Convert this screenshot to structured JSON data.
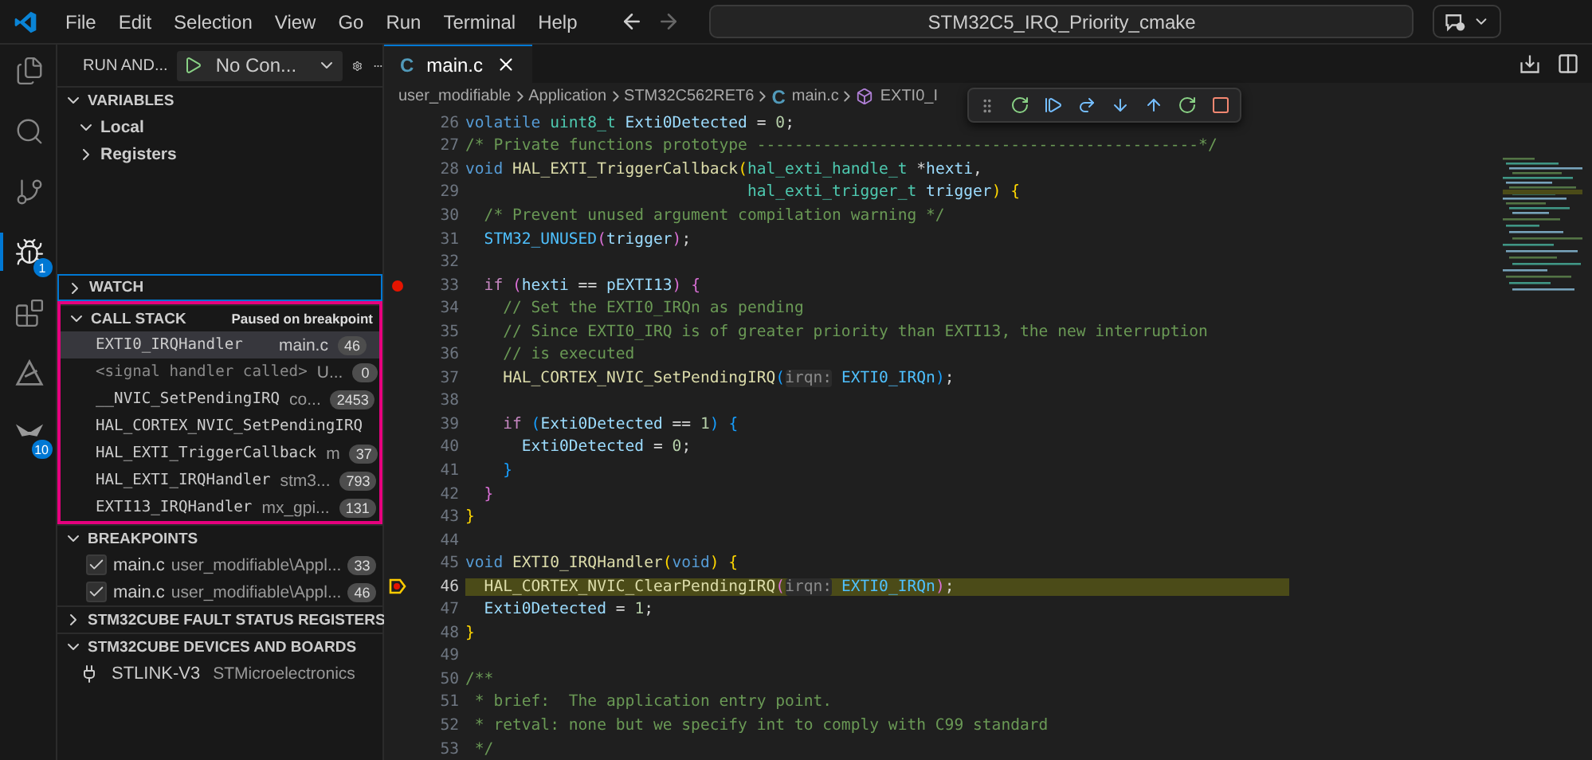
{
  "menu": [
    "File",
    "Edit",
    "Selection",
    "View",
    "Go",
    "Run",
    "Terminal",
    "Help"
  ],
  "command_center": {
    "value": "STM32C5_IRQ_Priority_cmake"
  },
  "activity_bar": [
    {
      "kind": "files",
      "selected": false
    },
    {
      "kind": "search",
      "selected": false
    },
    {
      "kind": "source-control",
      "selected": false
    },
    {
      "kind": "debug",
      "selected": true,
      "badge": "1"
    },
    {
      "kind": "extensions",
      "selected": false
    },
    {
      "kind": "triangle",
      "selected": false
    },
    {
      "kind": "stm",
      "selected": false,
      "badge": "10"
    }
  ],
  "sidebar": {
    "title": "RUN AND...",
    "config": "No Con...",
    "variables": {
      "title": "VARIABLES",
      "expanded": true,
      "items": [
        {
          "label": "Local",
          "expanded": true
        },
        {
          "label": "Registers",
          "expanded": false
        }
      ]
    },
    "watch": {
      "title": "WATCH",
      "expanded": false
    },
    "call_stack": {
      "title": "CALL STACK",
      "expanded": true,
      "status": "Paused on breakpoint",
      "frames": [
        {
          "name": "EXTI0_IRQHandler",
          "file": "main.c",
          "line": "46",
          "selected": true,
          "dimmed": false
        },
        {
          "name": "<signal handler called>",
          "file": "U...",
          "line": "0",
          "selected": false,
          "dimmed": true
        },
        {
          "name": "__NVIC_SetPendingIRQ",
          "file": "co...",
          "line": "2453",
          "selected": false,
          "dimmed": false
        },
        {
          "name": "HAL_CORTEX_NVIC_SetPendingIRQ",
          "selected": false,
          "dimmed": false
        },
        {
          "name": "HAL_EXTI_TriggerCallback",
          "file": "m",
          "line": "37",
          "selected": false,
          "dimmed": false
        },
        {
          "name": "HAL_EXTI_IRQHandler",
          "file": "stm3...",
          "line": "793",
          "selected": false,
          "dimmed": false
        },
        {
          "name": "EXTI13_IRQHandler",
          "file": "mx_gpi...",
          "line": "131",
          "selected": false,
          "dimmed": false
        }
      ]
    },
    "breakpoints": {
      "title": "BREAKPOINTS",
      "expanded": true,
      "items": [
        {
          "file": "main.c",
          "path": "user_modifiable\\Appl...",
          "line": "33",
          "checked": true
        },
        {
          "file": "main.c",
          "path": "user_modifiable\\Appl...",
          "line": "46",
          "checked": true
        }
      ]
    },
    "fault": {
      "title": "STM32CUBE FAULT STATUS REGISTERS",
      "expanded": false
    },
    "devices": {
      "title": "STM32CUBE DEVICES AND BOARDS",
      "expanded": true,
      "items": [
        {
          "name": "STLINK-V3",
          "vendor": "STMicroelectronics"
        }
      ]
    }
  },
  "editor": {
    "tab": {
      "label": "main.c",
      "icon": "C"
    },
    "breadcrumbs": [
      {
        "label": "user_modifiable",
        "kind": "folder"
      },
      {
        "label": "Application",
        "kind": "folder"
      },
      {
        "label": "STM32C562RET6",
        "kind": "folder"
      },
      {
        "label": "main.c",
        "kind": "file",
        "icon": "C"
      },
      {
        "label": "EXTI0_I",
        "kind": "symbol"
      }
    ],
    "lines": [
      {
        "number": "26",
        "breakpoint": false,
        "current": false,
        "tokens": [
          {
            "t": "volatile ",
            "kind": "kw"
          },
          {
            "t": "uint8_t ",
            "kind": "type"
          },
          {
            "t": "Exti0Detected",
            "kind": "var"
          },
          {
            "t": " = ",
            "kind": "punc"
          },
          {
            "t": "0",
            "kind": "num"
          },
          {
            "t": ";",
            "kind": "punc"
          }
        ]
      },
      {
        "number": "27",
        "breakpoint": false,
        "current": false,
        "tokens": [
          {
            "t": "/* Private functions prototype -----------------------------------------------*/",
            "kind": "comment"
          }
        ]
      },
      {
        "number": "28",
        "breakpoint": false,
        "current": false,
        "tokens": [
          {
            "t": "void ",
            "kind": "kw"
          },
          {
            "t": "HAL_EXTI_TriggerCallback",
            "kind": "fn"
          },
          {
            "t": "(",
            "kind": "b1"
          },
          {
            "t": "hal_exti_handle_t",
            "kind": "type"
          },
          {
            "t": " *",
            "kind": "punc"
          },
          {
            "t": "hexti",
            "kind": "var"
          },
          {
            "t": ",",
            "kind": "punc"
          }
        ]
      },
      {
        "number": "29",
        "breakpoint": false,
        "current": false,
        "tokens": [
          {
            "t": "                              hal_exti_trigger_t ",
            "kind": "type"
          },
          {
            "t": "trigger",
            "kind": "var"
          },
          {
            "t": ")",
            "kind": "b1"
          },
          {
            "t": " {",
            "kind": "b1"
          }
        ]
      },
      {
        "number": "30",
        "breakpoint": false,
        "current": false,
        "tokens": [
          {
            "t": "  /* Prevent unused argument compilation warning */",
            "kind": "comment"
          }
        ]
      },
      {
        "number": "31",
        "breakpoint": false,
        "current": false,
        "tokens": [
          {
            "t": "  STM32_UNUSED",
            "kind": "macro"
          },
          {
            "t": "(",
            "kind": "b2"
          },
          {
            "t": "trigger",
            "kind": "var"
          },
          {
            "t": ")",
            "kind": "b2"
          },
          {
            "t": ";",
            "kind": "punc"
          }
        ]
      },
      {
        "number": "32",
        "breakpoint": false,
        "current": false
      },
      {
        "number": "33",
        "breakpoint": true,
        "current": false,
        "tokens": [
          {
            "t": "  if ",
            "kind": "ctl"
          },
          {
            "t": "(",
            "kind": "b2"
          },
          {
            "t": "hexti",
            "kind": "var"
          },
          {
            "t": " == ",
            "kind": "punc"
          },
          {
            "t": "pEXTI13",
            "kind": "var"
          },
          {
            "t": ")",
            "kind": "b2"
          },
          {
            "t": " {",
            "kind": "b2"
          }
        ]
      },
      {
        "number": "34",
        "breakpoint": false,
        "current": false,
        "tokens": [
          {
            "t": "    // Set the EXTI0_IRQn as pending",
            "kind": "comment"
          }
        ]
      },
      {
        "number": "35",
        "breakpoint": false,
        "current": false,
        "tokens": [
          {
            "t": "    // Since EXTI0_IRQ is of greater priority than EXTI13, the new interruption",
            "kind": "comment"
          }
        ]
      },
      {
        "number": "36",
        "breakpoint": false,
        "current": false,
        "tokens": [
          {
            "t": "    // is executed",
            "kind": "comment"
          }
        ]
      },
      {
        "number": "37",
        "breakpoint": false,
        "current": false,
        "tokens": [
          {
            "t": "    HAL_CORTEX_NVIC_SetPendingIRQ",
            "kind": "fn"
          },
          {
            "t": "(",
            "kind": "b3"
          },
          {
            "t": "irqn:",
            "kind": "hint"
          },
          {
            "t": " EXTI0_IRQn",
            "kind": "macro"
          },
          {
            "t": ")",
            "kind": "b3"
          },
          {
            "t": ";",
            "kind": "punc"
          }
        ]
      },
      {
        "number": "38",
        "breakpoint": false,
        "current": false
      },
      {
        "number": "39",
        "breakpoint": false,
        "current": false,
        "tokens": [
          {
            "t": "    if ",
            "kind": "ctl"
          },
          {
            "t": "(",
            "kind": "b3"
          },
          {
            "t": "Exti0Detected",
            "kind": "var"
          },
          {
            "t": " == ",
            "kind": "punc"
          },
          {
            "t": "1",
            "kind": "num"
          },
          {
            "t": ")",
            "kind": "b3"
          },
          {
            "t": " {",
            "kind": "b3"
          }
        ]
      },
      {
        "number": "40",
        "breakpoint": false,
        "current": false,
        "tokens": [
          {
            "t": "      Exti0Detected",
            "kind": "var"
          },
          {
            "t": " = ",
            "kind": "punc"
          },
          {
            "t": "0",
            "kind": "num"
          },
          {
            "t": ";",
            "kind": "punc"
          }
        ]
      },
      {
        "number": "41",
        "breakpoint": false,
        "current": false,
        "tokens": [
          {
            "t": "    }",
            "kind": "b3"
          }
        ]
      },
      {
        "number": "42",
        "breakpoint": false,
        "current": false,
        "tokens": [
          {
            "t": "  }",
            "kind": "b2"
          }
        ]
      },
      {
        "number": "43",
        "breakpoint": false,
        "current": false,
        "tokens": [
          {
            "t": "}",
            "kind": "b1"
          }
        ]
      },
      {
        "number": "44",
        "breakpoint": false,
        "current": false
      },
      {
        "number": "45",
        "breakpoint": false,
        "current": false,
        "tokens": [
          {
            "t": "void ",
            "kind": "kw"
          },
          {
            "t": "EXTI0_IRQHandler",
            "kind": "fn"
          },
          {
            "t": "(",
            "kind": "b1"
          },
          {
            "t": "void",
            "kind": "kw"
          },
          {
            "t": ")",
            "kind": "b1"
          },
          {
            "t": " {",
            "kind": "b1"
          }
        ]
      },
      {
        "number": "46",
        "breakpoint": true,
        "current": true,
        "tokens": [
          {
            "t": "  HAL_CORTEX_NVIC_ClearPendingIRQ",
            "kind": "fn"
          },
          {
            "t": "(",
            "kind": "b2"
          },
          {
            "t": "irqn:",
            "kind": "hint"
          },
          {
            "t": " EXTI0_IRQn",
            "kind": "macro"
          },
          {
            "t": ")",
            "kind": "b2"
          },
          {
            "t": ";",
            "kind": "punc"
          }
        ]
      },
      {
        "number": "47",
        "breakpoint": false,
        "current": false,
        "tokens": [
          {
            "t": "  Exti0Detected",
            "kind": "var"
          },
          {
            "t": " = ",
            "kind": "punc"
          },
          {
            "t": "1",
            "kind": "num"
          },
          {
            "t": ";",
            "kind": "punc"
          }
        ]
      },
      {
        "number": "48",
        "breakpoint": false,
        "current": false,
        "tokens": [
          {
            "t": "}",
            "kind": "b1"
          }
        ]
      },
      {
        "number": "49",
        "breakpoint": false,
        "current": false
      },
      {
        "number": "50",
        "breakpoint": false,
        "current": false,
        "tokens": [
          {
            "t": "/**",
            "kind": "comment"
          }
        ]
      },
      {
        "number": "51",
        "breakpoint": false,
        "current": false,
        "tokens": [
          {
            "t": " * brief:  The application entry point.",
            "kind": "comment"
          }
        ]
      },
      {
        "number": "52",
        "breakpoint": false,
        "current": false,
        "tokens": [
          {
            "t": " * retval: none but we specify int to comply with C99 standard",
            "kind": "comment"
          }
        ]
      },
      {
        "number": "53",
        "breakpoint": false,
        "current": false,
        "tokens": [
          {
            "t": " */",
            "kind": "comment"
          }
        ]
      }
    ]
  }
}
